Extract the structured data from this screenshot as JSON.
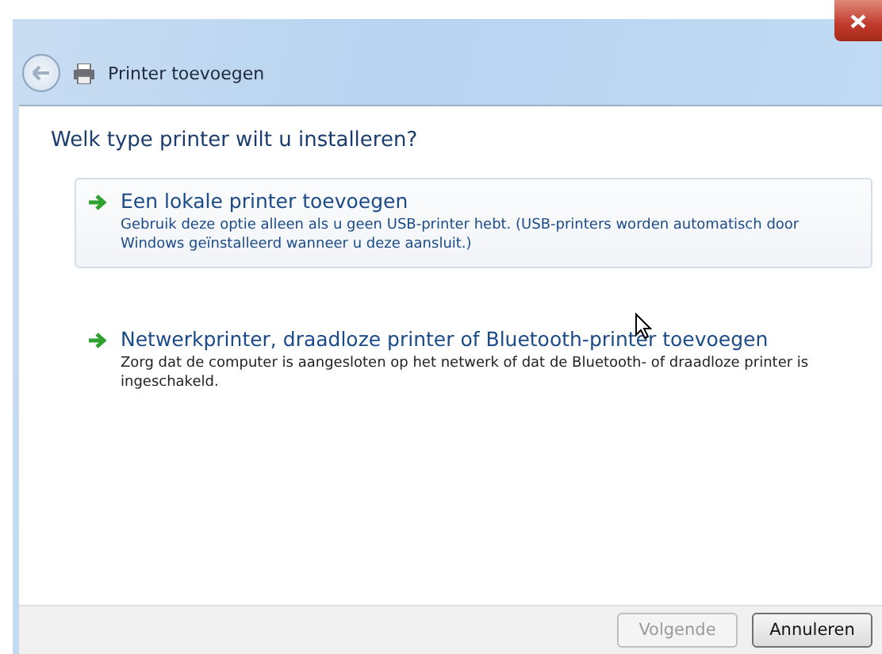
{
  "window": {
    "title": "Printer toevoegen"
  },
  "heading": "Welk type printer wilt u installeren?",
  "options": [
    {
      "title": "Een lokale printer toevoegen",
      "description": "Gebruik deze optie alleen als u geen USB-printer hebt. (USB-printers worden automatisch door Windows geïnstalleerd wanneer u deze aansluit.)",
      "highlighted": true
    },
    {
      "title": "Netwerkprinter, draadloze printer of Bluetooth-printer toevoegen",
      "description": "Zorg dat de computer is aangesloten op het netwerk of dat de Bluetooth- of draadloze printer is ingeschakeld.",
      "highlighted": false
    }
  ],
  "buttons": [
    {
      "label": "Volgende",
      "disabled": true
    },
    {
      "label": "Annuleren",
      "disabled": false
    }
  ]
}
